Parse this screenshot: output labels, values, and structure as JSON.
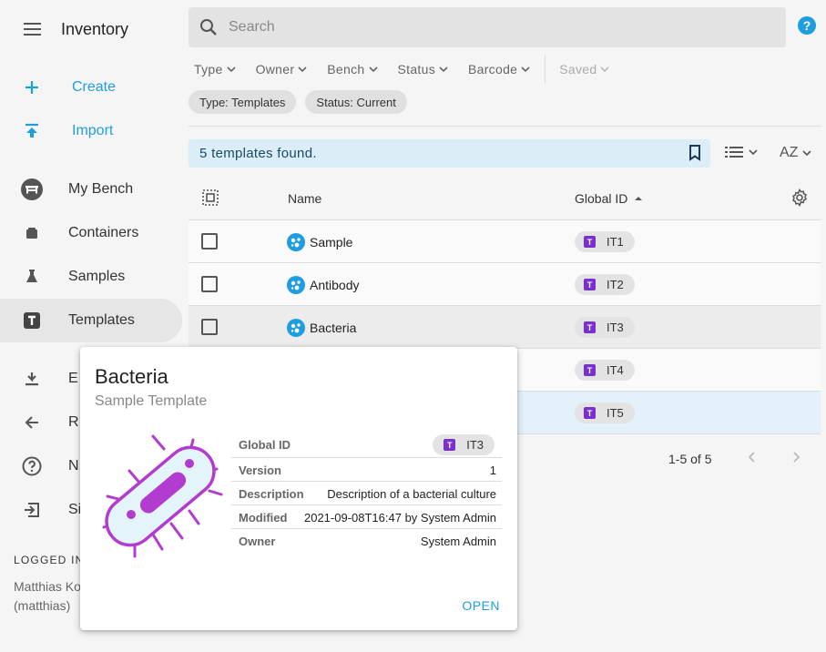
{
  "app": {
    "title": "Inventory"
  },
  "sidebar": {
    "actions": [
      {
        "label": "Create",
        "icon": "plus-icon"
      },
      {
        "label": "Import",
        "icon": "upload-icon"
      }
    ],
    "items": [
      {
        "label": "My Bench",
        "icon": "bench-icon"
      },
      {
        "label": "Containers",
        "icon": "box-icon"
      },
      {
        "label": "Samples",
        "icon": "flask-icon"
      },
      {
        "label": "Templates",
        "icon": "template-icon"
      },
      {
        "label": "E",
        "icon": "download-icon"
      },
      {
        "label": "R",
        "icon": "arrow-left-icon"
      },
      {
        "label": "N",
        "icon": "help-circle-icon"
      },
      {
        "label": "Si",
        "icon": "sign-in-icon"
      }
    ],
    "logged_in_label": "LOGGED IN",
    "user_line1": "Matthias Ko",
    "user_line2": "(matthias)"
  },
  "search": {
    "placeholder": "Search"
  },
  "filters": [
    "Type",
    "Owner",
    "Bench",
    "Status",
    "Barcode"
  ],
  "saved_label": "Saved",
  "chips": [
    "Type: Templates",
    "Status: Current"
  ],
  "results": {
    "found_text": "5 templates found.",
    "sort_label": "AZ"
  },
  "table": {
    "headers": {
      "name": "Name",
      "global_id": "Global ID"
    },
    "rows": [
      {
        "name": "Sample",
        "gid": "IT1"
      },
      {
        "name": "Antibody",
        "gid": "IT2"
      },
      {
        "name": "Bacteria",
        "gid": "IT3"
      },
      {
        "name": "",
        "gid": "IT4"
      },
      {
        "name": "",
        "gid": "IT5"
      }
    ],
    "badge_letter": "T"
  },
  "pagination": {
    "text": "1-5 of 5"
  },
  "card": {
    "title": "Bacteria",
    "subtitle": "Sample Template",
    "fields": {
      "global_id_label": "Global ID",
      "global_id": "IT3",
      "version_label": "Version",
      "version": "1",
      "description_label": "Description",
      "description": "Description of a bacterial culture",
      "modified_label": "Modified",
      "modified": "2021-09-08T16:47 by System Admin",
      "owner_label": "Owner",
      "owner": "System Admin"
    },
    "open_label": "OPEN"
  },
  "colors": {
    "accent": "#1e9ee0",
    "badge": "#7b2fd0",
    "bacteria": "#b23bd0"
  }
}
